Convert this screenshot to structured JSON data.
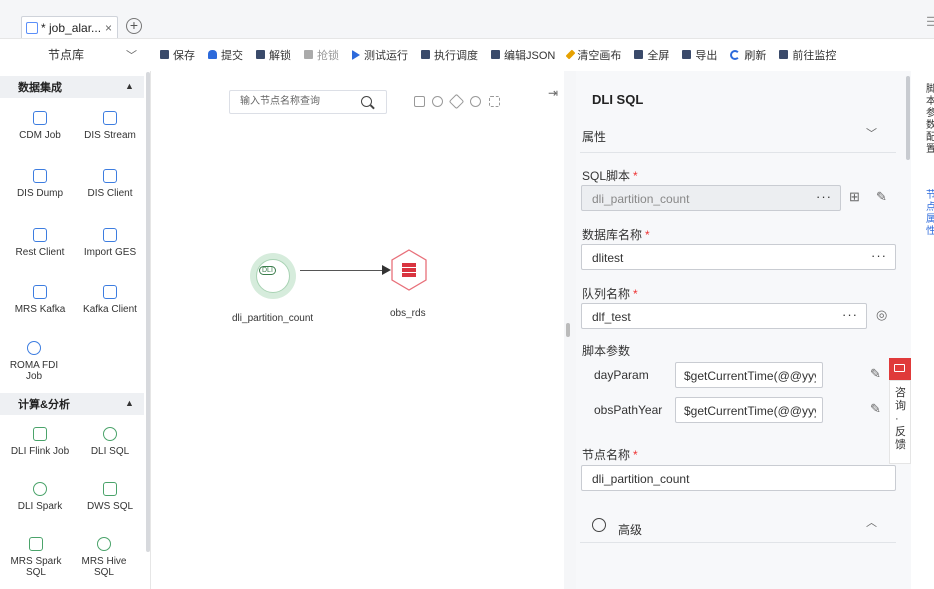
{
  "tab": {
    "title": "* job_alar...",
    "close": "×",
    "add": "+"
  },
  "window_menu": "☰",
  "nodelib": {
    "label": "节点库",
    "chevron": "﹀"
  },
  "toolbar": [
    {
      "label": "保存",
      "enabled": true,
      "icon": "save-icon"
    },
    {
      "label": "提交",
      "enabled": true,
      "icon": "cloud-upload-icon"
    },
    {
      "label": "解锁",
      "enabled": true,
      "icon": "unlock-icon"
    },
    {
      "label": "抢锁",
      "enabled": false,
      "icon": "lock-icon"
    },
    {
      "label": "测试运行",
      "enabled": true,
      "icon": "play-icon"
    },
    {
      "label": "执行调度",
      "enabled": true,
      "icon": "schedule-icon"
    },
    {
      "label": "编辑JSON",
      "enabled": true,
      "icon": "json-icon"
    },
    {
      "label": "清空画布",
      "enabled": true,
      "icon": "eraser-icon"
    },
    {
      "label": "全屏",
      "enabled": true,
      "icon": "fullscreen-icon"
    },
    {
      "label": "导出",
      "enabled": true,
      "icon": "export-icon"
    },
    {
      "label": "刷新",
      "enabled": true,
      "icon": "refresh-icon"
    },
    {
      "label": "前往监控",
      "enabled": true,
      "icon": "monitor-icon"
    }
  ],
  "sidebar": {
    "sections": [
      {
        "title": "数据集成",
        "collapse": "▲"
      },
      {
        "title": "计算&分析",
        "collapse": "▲"
      }
    ],
    "nodes": [
      {
        "label": "CDM Job",
        "icon": "cdm-icon"
      },
      {
        "label": "DIS Stream",
        "icon": "dis-stream-icon"
      },
      {
        "label": "DIS Dump",
        "icon": "dis-dump-icon"
      },
      {
        "label": "DIS Client",
        "icon": "dis-client-icon"
      },
      {
        "label": "Rest Client",
        "icon": "rest-client-icon"
      },
      {
        "label": "Import GES",
        "icon": "import-ges-icon"
      },
      {
        "label": "MRS Kafka",
        "icon": "mrs-kafka-icon"
      },
      {
        "label": "Kafka Client",
        "icon": "kafka-client-icon"
      },
      {
        "label": "ROMA FDI Job",
        "icon": "roma-fdi-icon"
      },
      {
        "label": "DLI Flink Job",
        "icon": "dli-flink-icon"
      },
      {
        "label": "DLI SQL",
        "icon": "dli-sql-icon"
      },
      {
        "label": "DLI Spark",
        "icon": "dli-spark-icon"
      },
      {
        "label": "DWS SQL",
        "icon": "dws-sql-icon"
      },
      {
        "label": "MRS Spark SQL",
        "icon": "mrs-spark-sql-icon"
      },
      {
        "label": "MRS Hive SQL",
        "icon": "mrs-hive-sql-icon"
      }
    ]
  },
  "canvas": {
    "search_placeholder": "输入节点名称查询",
    "nodes": [
      {
        "label": "dli_partition_count",
        "badge": "DLI"
      },
      {
        "label": "obs_rds"
      }
    ]
  },
  "panel": {
    "title": "DLI SQL",
    "section_attr": "属性",
    "fields": {
      "sql_script": {
        "label": "SQL脚本",
        "value": "dli_partition_count"
      },
      "database": {
        "label": "数据库名称",
        "value": "dlitest"
      },
      "queue": {
        "label": "队列名称",
        "value": "dlf_test"
      },
      "script_params": {
        "label": "脚本参数"
      },
      "node_name": {
        "label": "节点名称",
        "value": "dli_partition_count"
      }
    },
    "params": [
      {
        "name": "dayParam",
        "value": "$getCurrentTime(@@yyyyMMdd"
      },
      {
        "name": "obsPathYear",
        "value": "$getCurrentTime(@@yyyy/MM/"
      }
    ],
    "required_mark": "*",
    "dots": "···",
    "advanced": "高级"
  },
  "right_edge": {
    "text1": "脚本参数配置",
    "text2": "节点属性"
  },
  "feedback": {
    "text": "咨询·反馈"
  },
  "colors": {
    "accent": "#2d6adb",
    "node_green": "#d6ecdc",
    "feedback_red": "#e03a3a"
  }
}
